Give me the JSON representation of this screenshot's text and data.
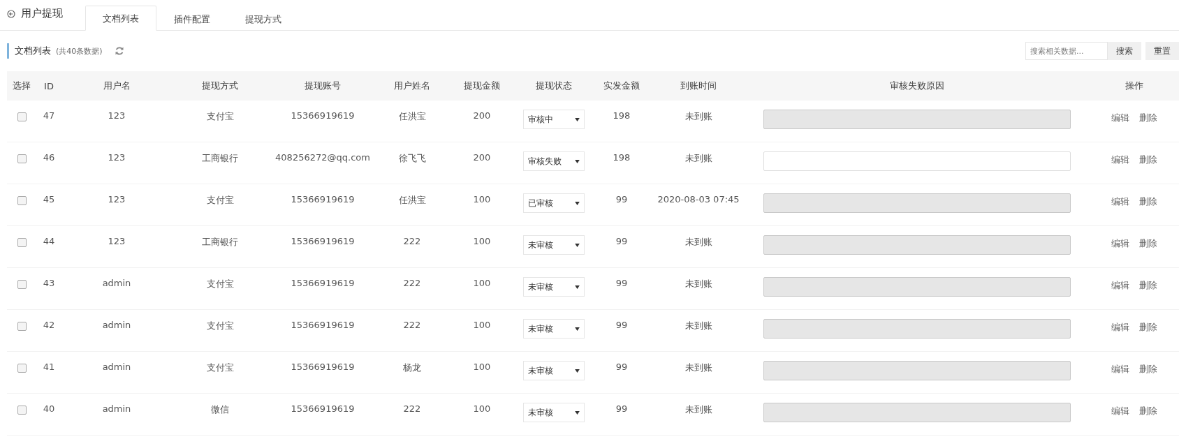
{
  "header": {
    "title": "用户提现",
    "tabs": [
      {
        "label": "文档列表",
        "selected": true
      },
      {
        "label": "插件配置",
        "selected": false
      },
      {
        "label": "提现方式",
        "selected": false
      }
    ]
  },
  "toolbar": {
    "title": "文档列表",
    "count": "(共40条数据)",
    "search": {
      "placeholder": "搜索相关数据..."
    },
    "buttons": [
      "搜索",
      "重置"
    ]
  },
  "table": {
    "columns": [
      "选择",
      "ID",
      "用户名",
      "提现方式",
      "提现账号",
      "用户姓名",
      "提现金额",
      "提现状态",
      "实发金额",
      "到账时间",
      "审核失败原因",
      "操作"
    ],
    "rows": [
      {
        "checked": false,
        "id": "47",
        "user": "123",
        "method": "支付宝",
        "account": "15366919619",
        "name": "任洪宝",
        "amount": "200",
        "status": "审核中",
        "paid": "198",
        "time": "未到账",
        "reason_disabled": true,
        "actions": [
          "编辑",
          "删除"
        ]
      },
      {
        "checked": false,
        "id": "46",
        "user": "123",
        "method": "工商银行",
        "account": "408256272@qq.com",
        "name": "徐飞飞",
        "amount": "200",
        "status": "审核失败",
        "paid": "198",
        "time": "未到账",
        "reason_disabled": false,
        "actions": [
          "编辑",
          "删除"
        ]
      },
      {
        "checked": false,
        "id": "45",
        "user": "123",
        "method": "支付宝",
        "account": "15366919619",
        "name": "任洪宝",
        "amount": "100",
        "status": "已审核",
        "paid": "99",
        "time": "2020-08-03 07:45",
        "reason_disabled": true,
        "actions": [
          "编辑",
          "删除"
        ]
      },
      {
        "checked": false,
        "id": "44",
        "user": "123",
        "method": "工商银行",
        "account": "15366919619",
        "name": "222",
        "amount": "100",
        "status": "未审核",
        "paid": "99",
        "time": "未到账",
        "reason_disabled": true,
        "actions": [
          "编辑",
          "删除"
        ]
      },
      {
        "checked": false,
        "id": "43",
        "user": "admin",
        "method": "支付宝",
        "account": "15366919619",
        "name": "222",
        "amount": "100",
        "status": "未审核",
        "paid": "99",
        "time": "未到账",
        "reason_disabled": true,
        "actions": [
          "编辑",
          "删除"
        ]
      },
      {
        "checked": false,
        "id": "42",
        "user": "admin",
        "method": "支付宝",
        "account": "15366919619",
        "name": "222",
        "amount": "100",
        "status": "未审核",
        "paid": "99",
        "time": "未到账",
        "reason_disabled": true,
        "actions": [
          "编辑",
          "删除"
        ]
      },
      {
        "checked": false,
        "id": "41",
        "user": "admin",
        "method": "支付宝",
        "account": "15366919619",
        "name": "杨龙",
        "amount": "100",
        "status": "未审核",
        "paid": "99",
        "time": "未到账",
        "reason_disabled": true,
        "actions": [
          "编辑",
          "删除"
        ]
      },
      {
        "checked": false,
        "id": "40",
        "user": "admin",
        "method": "微信",
        "account": "15366919619",
        "name": "222",
        "amount": "100",
        "status": "未审核",
        "paid": "99",
        "time": "未到账",
        "reason_disabled": true,
        "actions": [
          "编辑",
          "删除"
        ]
      }
    ]
  }
}
